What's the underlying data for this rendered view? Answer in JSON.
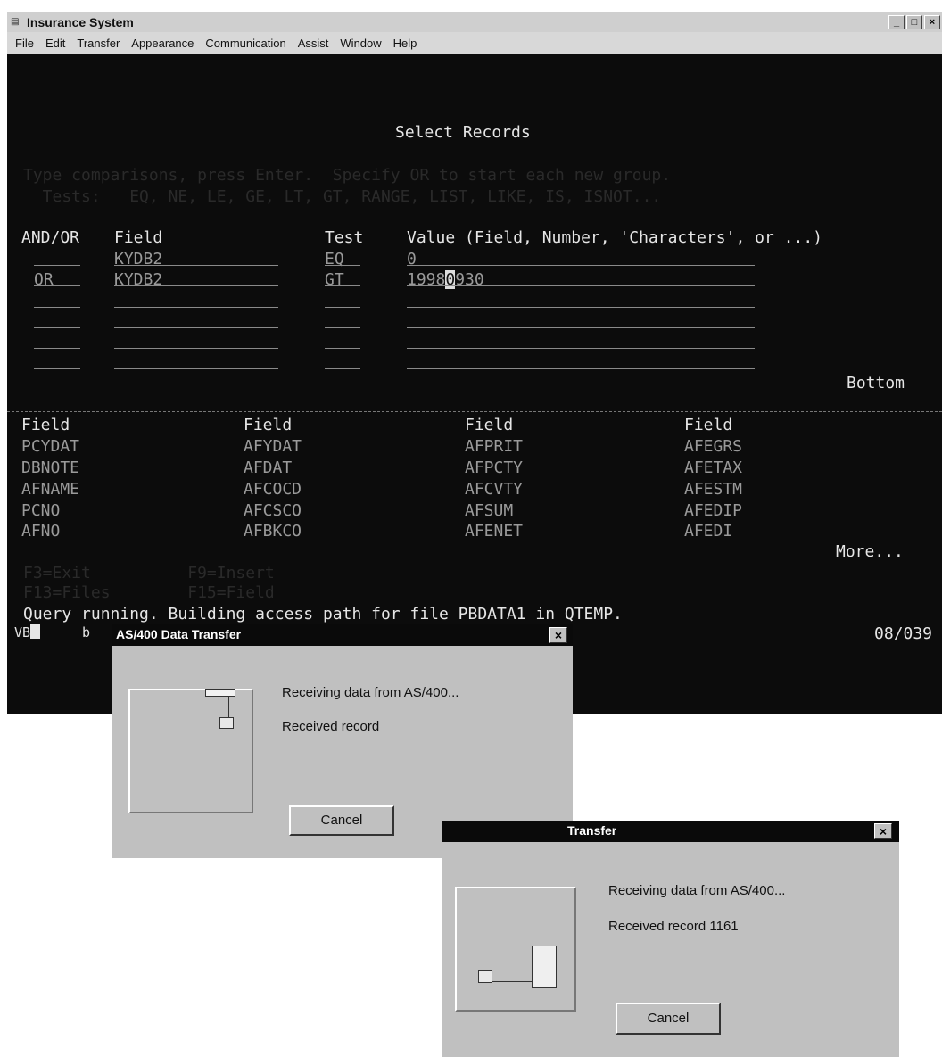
{
  "window": {
    "title": "Insurance System",
    "menu": [
      "File",
      "Edit",
      "Transfer",
      "Appearance",
      "Communication",
      "Assist",
      "Window",
      "Help"
    ]
  },
  "screen": {
    "heading": "Select Records",
    "instructions_1": "Type comparisons, press Enter.  Specify OR to start each new group.",
    "instructions_2": "  Tests:   EQ, NE, LE, GE, LT, GT, RANGE, LIST, LIKE, IS, ISNOT...",
    "col_andor": "AND/OR",
    "col_field": "Field",
    "col_test": "Test",
    "col_value": "Value (Field, Number, 'Characters', or ...)",
    "rows": [
      {
        "andor": "",
        "field": "KYDB2",
        "test": "EQ",
        "value": "0"
      },
      {
        "andor": "OR",
        "field": "KYDB2",
        "test": "GT",
        "value_pre": "1998",
        "value_cursor": "0",
        "value_post": "930"
      }
    ],
    "bottom_label": "Bottom",
    "field_headers": [
      "Field",
      "Field",
      "Field",
      "Field"
    ],
    "field_columns": [
      [
        "PCYDAT",
        "DBNOTE",
        "AFNAME",
        "PCNO",
        "AFNO"
      ],
      [
        "AFYDAT",
        "AFDAT",
        "AFCOCD",
        "AFCSCO",
        "AFBKCO"
      ],
      [
        "AFPRIT",
        "AFPCTY",
        "AFCVTY",
        "AFSUM",
        "AFENET"
      ],
      [
        "AFEGRS",
        "AFETAX",
        "AFESTM",
        "AFEDIP",
        "AFEDI"
      ]
    ],
    "more_label": "More...",
    "fkeys_1": "F3=Exit          F9=Insert",
    "fkeys_2": "F13=Files        F15=Field",
    "status_message": "Query running. Building access path for file PBDATA1 in QTEMP.",
    "status_left_a": "VB",
    "status_left_b": "b",
    "status_position": "08/039"
  },
  "dialog1": {
    "title": "AS/400 Data Transfer",
    "line1": "Receiving data from AS/400...",
    "line2": "Received record",
    "cancel": "Cancel"
  },
  "dialog2": {
    "title": "Transfer",
    "line1": "Receiving data from AS/400...",
    "line2": "Received record 1161",
    "cancel": "Cancel"
  }
}
